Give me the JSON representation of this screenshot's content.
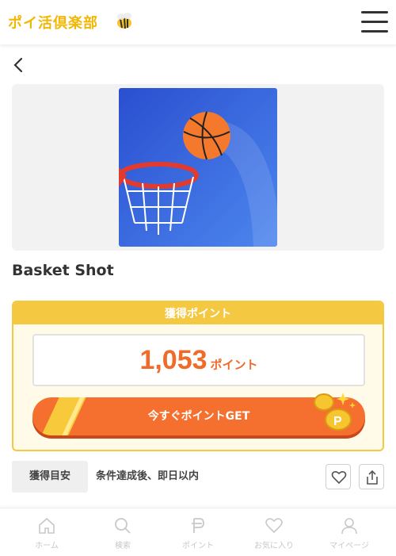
{
  "header": {
    "logo_text": "ポイ活倶楽部",
    "logo_bee_icon": "bee-icon",
    "menu_icon": "hamburger-menu-icon"
  },
  "nav": {
    "back_icon": "chevron-left-icon"
  },
  "app": {
    "name": "Basket Shot",
    "image_icon": "basketball-hoop-icon"
  },
  "points": {
    "header_label": "獲得ポイント",
    "value": "1,053",
    "unit": "ポイント",
    "get_button_label": "今すぐポイントGET",
    "coins_icon": "gold-coins-icon"
  },
  "meta": {
    "label": "獲得目安",
    "value": "条件達成後、即日以内",
    "favorite_icon": "heart-icon",
    "share_icon": "share-icon"
  },
  "tabbar": {
    "items": [
      {
        "label": "ホーム",
        "icon": "home-icon"
      },
      {
        "label": "検索",
        "icon": "search-icon"
      },
      {
        "label": "ポイント",
        "icon": "point-p-icon"
      },
      {
        "label": "お気に入り",
        "icon": "heart-icon"
      },
      {
        "label": "マイページ",
        "icon": "user-icon"
      }
    ]
  },
  "colors": {
    "brand_yellow": "#f5c842",
    "accent_orange": "#f5702f",
    "points_orange": "#f06a2a",
    "hero_blue": "#3a62dc"
  }
}
